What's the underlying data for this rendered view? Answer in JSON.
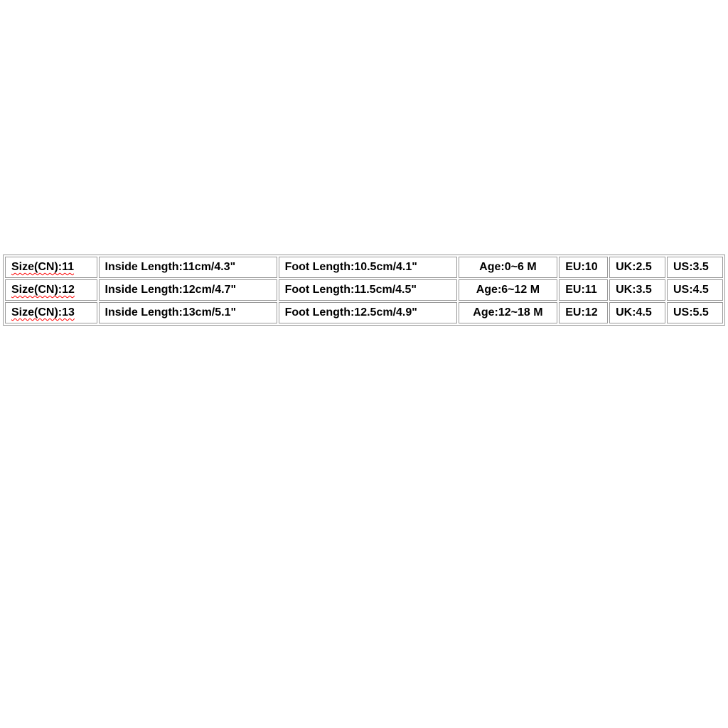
{
  "chart_data": {
    "type": "table",
    "rows": [
      {
        "size_cn": "Size(CN):11",
        "inside": "Inside Length:11cm/4.3\"",
        "foot": "Foot Length:10.5cm/4.1\"",
        "age": "Age:0~6 M",
        "eu": "EU:10",
        "uk": "UK:2.5",
        "us": "US:3.5"
      },
      {
        "size_cn": "Size(CN):12",
        "inside": "Inside Length:12cm/4.7\"",
        "foot": "Foot Length:11.5cm/4.5\"",
        "age": "Age:6~12 M",
        "eu": "EU:11",
        "uk": "UK:3.5",
        "us": "US:4.5"
      },
      {
        "size_cn": "Size(CN):13",
        "inside": "Inside Length:13cm/5.1\"",
        "foot": "Foot Length:12.5cm/4.9\"",
        "age": "Age:12~18 M",
        "eu": "EU:12",
        "uk": "UK:4.5",
        "us": "US:5.5"
      }
    ]
  }
}
